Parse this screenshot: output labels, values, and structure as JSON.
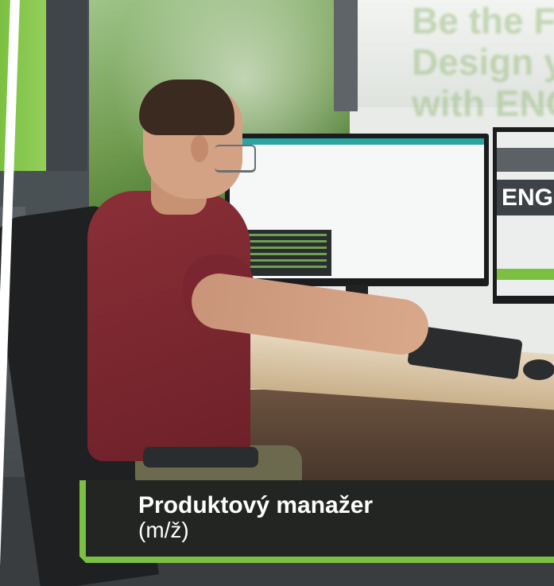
{
  "photo": {
    "wall_lines": [
      "Be the F",
      "Design y",
      "with ENG"
    ],
    "right_monitor_text": "ENG"
  },
  "job_banner": {
    "title": "Produktový manažer",
    "subtitle": "(m/ž)",
    "accent_color": "#7bc043",
    "background_color": "#1e1e20"
  }
}
